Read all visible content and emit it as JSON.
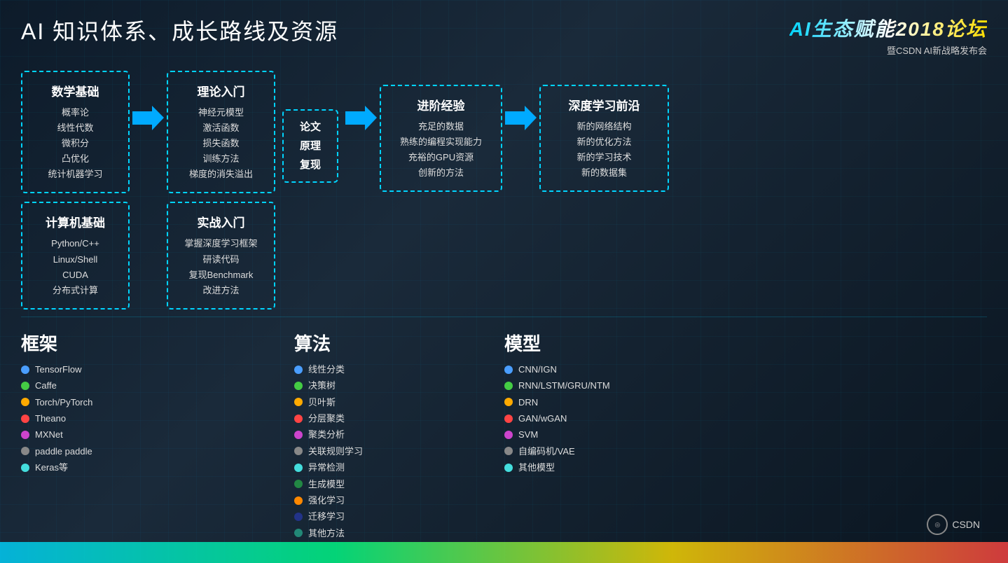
{
  "header": {
    "title": "AI 知识体系、成长路线及资源",
    "logo_title": "AI生态赋能2018论坛",
    "logo_subtitle": "暨CSDN AI新战略发布会"
  },
  "boxes": {
    "math_foundation": {
      "title": "数学基础",
      "items": [
        "概率论",
        "线性代数",
        "微积分",
        "凸优化",
        "统计机器学习"
      ]
    },
    "computer_foundation": {
      "title": "计算机基础",
      "items": [
        "Python/C++",
        "Linux/Shell",
        "CUDA",
        "分布式计算"
      ]
    },
    "theory_intro": {
      "title": "理论入门",
      "items": [
        "神经元模型",
        "激活函数",
        "损失函数",
        "训练方法",
        "梯度的消失溢出"
      ]
    },
    "practice_intro": {
      "title": "实战入门",
      "items": [
        "掌握深度学习框架",
        "研读代码",
        "复现Benchmark",
        "改进方法"
      ]
    },
    "paper": {
      "text": "论文\n原理\n复现"
    },
    "advanced": {
      "title": "进阶经验",
      "items": [
        "充足的数据",
        "熟练的编程实现能力",
        "充裕的GPU资源",
        "创新的方法"
      ]
    },
    "frontier": {
      "title": "深度学习前沿",
      "items": [
        "新的网络结构",
        "新的优化方法",
        "新的学习技术",
        "新的数据集"
      ]
    }
  },
  "framework": {
    "label": "框架",
    "items": [
      {
        "color": "#4a9eff",
        "text": "TensorFlow"
      },
      {
        "color": "#44cc44",
        "text": "Caffe"
      },
      {
        "color": "#ffaa00",
        "text": "Torch/PyTorch"
      },
      {
        "color": "#ff4444",
        "text": "Theano"
      },
      {
        "color": "#cc44cc",
        "text": "MXNet"
      },
      {
        "color": "#888888",
        "text": "paddle paddle"
      },
      {
        "color": "#44dddd",
        "text": "Keras等"
      }
    ]
  },
  "algorithm": {
    "label": "算法",
    "items": [
      {
        "color": "#4a9eff",
        "text": "线性分类"
      },
      {
        "color": "#44cc44",
        "text": "决策树"
      },
      {
        "color": "#ffaa00",
        "text": "贝叶斯"
      },
      {
        "color": "#ff4444",
        "text": "分层聚类"
      },
      {
        "color": "#cc44cc",
        "text": "聚类分析"
      },
      {
        "color": "#888888",
        "text": "关联规则学习"
      },
      {
        "color": "#44dddd",
        "text": "异常检测"
      },
      {
        "color": "#228844",
        "text": "生成模型"
      },
      {
        "color": "#ff8800",
        "text": "强化学习"
      },
      {
        "color": "#223388",
        "text": "迁移学习"
      },
      {
        "color": "#228877",
        "text": "其他方法"
      }
    ]
  },
  "model": {
    "label": "模型",
    "items": [
      {
        "color": "#4a9eff",
        "text": "CNN/IGN"
      },
      {
        "color": "#44cc44",
        "text": "RNN/LSTM/GRU/NTM"
      },
      {
        "color": "#ffaa00",
        "text": "DRN"
      },
      {
        "color": "#ff4444",
        "text": "GAN/wGAN"
      },
      {
        "color": "#cc44cc",
        "text": "SVM"
      },
      {
        "color": "#888888",
        "text": "自编码机/VAE"
      },
      {
        "color": "#44dddd",
        "text": "其他模型"
      }
    ]
  },
  "csdn": {
    "text": "CSDN"
  }
}
